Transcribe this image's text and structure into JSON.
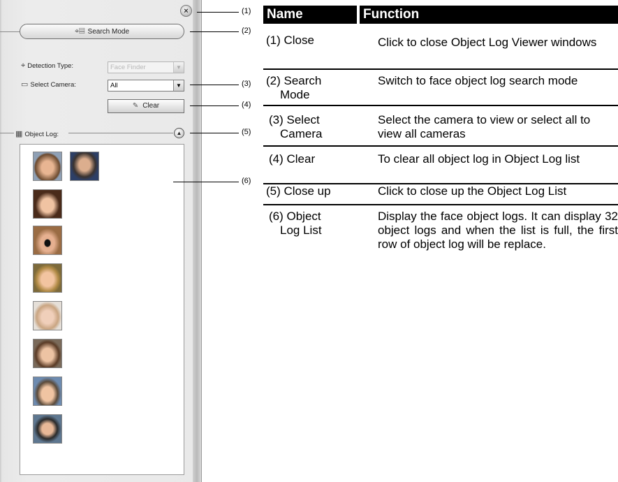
{
  "panel": {
    "close_glyph": "×",
    "search_mode_label": "Search Mode",
    "detection_type_label": "Detection Type:",
    "detection_type_value": "Face Finder",
    "select_camera_label": "Select Camera:",
    "select_camera_value": "All",
    "clear_label": "Clear",
    "object_log_label": "Object Log:",
    "collapse_glyph": "▲"
  },
  "callouts": [
    "(1)",
    "(2)",
    "(3)",
    "(4)",
    "(5)",
    "(6)"
  ],
  "table": {
    "header_name": "Name",
    "header_function": "Function",
    "rows": [
      {
        "name_1": "(1) Close",
        "name_2": "",
        "func": "Click to close Object Log Viewer windows"
      },
      {
        "name_1": "(2) Search",
        "name_2": "Mode",
        "func": "Switch to face object log search mode"
      },
      {
        "name_1": "(3) Select",
        "name_2": "Camera",
        "func": "Select the camera to view or select all to view all cameras"
      },
      {
        "name_1": "(4) Clear",
        "name_2": "",
        "func": "To clear all object log in Object Log list"
      },
      {
        "name_1": "(5) Close up",
        "name_2": "",
        "func": "Click to close up the Object Log List"
      },
      {
        "name_1": "(6) Object",
        "name_2": "Log List",
        "func": "Display the face object logs. It can display 32 object logs and when the list is full, the first row of object log will be replace."
      }
    ]
  },
  "colors": {
    "header_bg": "#000000",
    "header_text": "#ffffff"
  }
}
